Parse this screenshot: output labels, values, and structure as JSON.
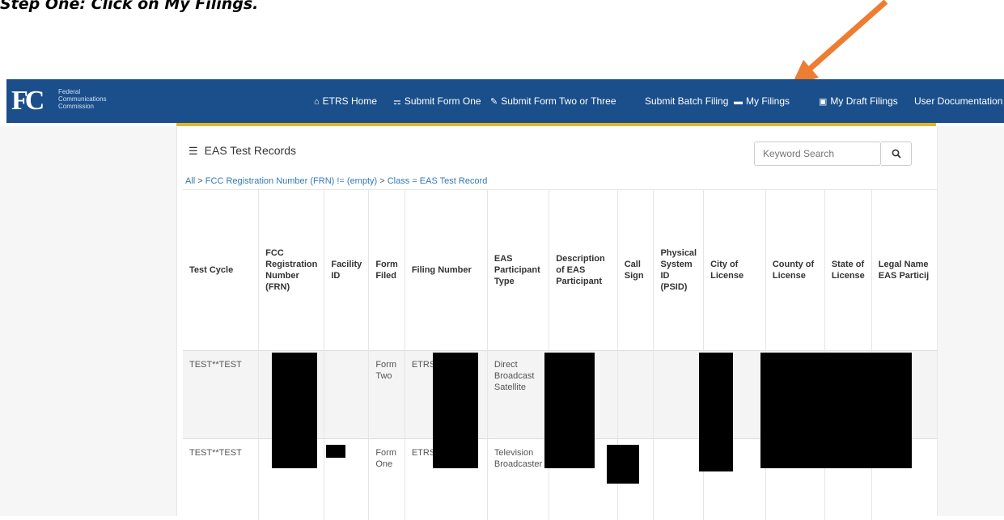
{
  "caption": "Step One: Click on My Filings.",
  "colors": {
    "nav_bg": "#1a4f8b",
    "accent_bar": "#e2b626",
    "arrow": "#ed7d31"
  },
  "logo": {
    "mark": "FC",
    "text": "Federal\nCommunications\nCommission"
  },
  "nav": {
    "items": [
      {
        "label": "ETRS Home",
        "icon": "home-icon"
      },
      {
        "label": "Submit Form One",
        "icon": "bullhorn-icon"
      },
      {
        "label": "Submit Form Two or Three",
        "icon": "edit-icon"
      },
      {
        "label": "Submit Batch Filing",
        "icon": ""
      },
      {
        "label": "My Filings",
        "icon": "folder-open-icon"
      },
      {
        "label": "My Draft Filings",
        "icon": "save-icon"
      },
      {
        "label": "User Documentation",
        "icon": ""
      }
    ]
  },
  "panel": {
    "title": "EAS Test Records",
    "search_placeholder": "Keyword Search",
    "breadcrumb": {
      "all": "All",
      "filter1": "FCC Registration Number (FRN) != (empty)",
      "filter2": "Class = EAS Test Record"
    }
  },
  "table": {
    "headers": [
      "Test Cycle",
      "FCC Registration Number (FRN)",
      "Facility ID",
      "Form Filed",
      "Filing Number",
      "EAS Participant Type",
      "Description of EAS Participant",
      "Call Sign",
      "Physical System ID (PSID)",
      "City of License",
      "County of License",
      "State of License",
      "Legal Name EAS Particij"
    ],
    "rows": [
      [
        "TEST**TEST",
        "",
        "",
        "Form\nTwo",
        "ETRS",
        "Direct\nBroadcast\nSatellite",
        "",
        "",
        "",
        "",
        "",
        "",
        ""
      ],
      [
        "TEST**TEST",
        "",
        "",
        "Form\nOne",
        "ETRS",
        "Television\nBroadcaster",
        "",
        "",
        "",
        "",
        "",
        "",
        ""
      ]
    ]
  }
}
